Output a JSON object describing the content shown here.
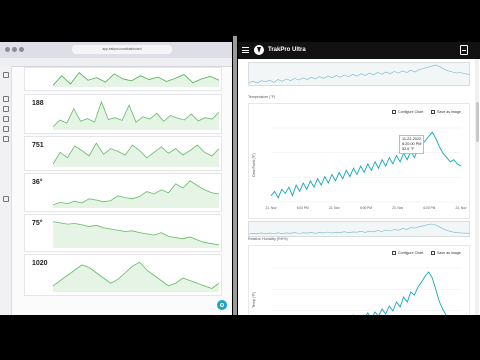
{
  "left_browser": {
    "url": "app.trakpro.com/dashboard",
    "panels": [
      {
        "value": "",
        "unit": "",
        "line_color": "#4caf50",
        "series": [
          40,
          55,
          42,
          60,
          48,
          52,
          45,
          58,
          50,
          47,
          55,
          49,
          53,
          46,
          51,
          57,
          44,
          50,
          54,
          48
        ]
      },
      {
        "value": "188",
        "unit": "",
        "line_color": "#66bb6a",
        "series": [
          30,
          45,
          38,
          70,
          42,
          48,
          40,
          85,
          46,
          50,
          44,
          78,
          40,
          52,
          47,
          60,
          42,
          55,
          49,
          45,
          58,
          43,
          50,
          47,
          62
        ]
      },
      {
        "value": "751",
        "unit": "",
        "line_color": "#66bb6a",
        "series": [
          35,
          48,
          42,
          55,
          50,
          44,
          58,
          46,
          52,
          49,
          45,
          56,
          50,
          42,
          48,
          54,
          47,
          52,
          45,
          50,
          56,
          48,
          44,
          52
        ]
      },
      {
        "value": "36",
        "unit": "°",
        "line_color": "#66bb6a",
        "series": [
          20,
          24,
          22,
          26,
          23,
          30,
          28,
          25,
          27,
          35,
          32,
          30,
          34,
          42,
          38,
          45,
          40,
          55,
          48,
          60,
          52,
          45,
          40,
          38
        ]
      },
      {
        "value": "75",
        "unit": "°",
        "line_color": "#66bb6a",
        "series": [
          60,
          58,
          56,
          57,
          55,
          52,
          54,
          50,
          48,
          46,
          44,
          45,
          42,
          40,
          38,
          42,
          36,
          34,
          32,
          35,
          30,
          26,
          24,
          22
        ]
      },
      {
        "value": "1020",
        "unit": "",
        "line_color": "#66bb6a",
        "series": [
          40,
          44,
          48,
          52,
          56,
          54,
          50,
          46,
          42,
          45,
          50,
          55,
          58,
          52,
          48,
          44,
          40,
          42,
          46,
          44,
          42,
          40,
          38,
          42
        ]
      }
    ]
  },
  "app": {
    "title": "TrakPro Ultra"
  },
  "right_charts": [
    {
      "section_label": "Temperature (°F)",
      "configure_label": "Configure Chart",
      "save_label": "Save as image",
      "ylabel": "Dew Point (°F)",
      "xticks": [
        "21. Nov",
        "6:00 PM",
        "22. Nov",
        "6:00 PM",
        "23. Nov",
        "6:00 PM",
        "24. Nov"
      ],
      "tooltip": [
        "11-22-2022",
        "6:20:00 PM",
        "52.6 °F"
      ],
      "line_color": "#19a3c3",
      "series": [
        38,
        42,
        36,
        44,
        40,
        46,
        38,
        48,
        42,
        50,
        44,
        52,
        46,
        54,
        48,
        56,
        50,
        58,
        52,
        60,
        54,
        62,
        56,
        64,
        58,
        66,
        60,
        68,
        62,
        70,
        64,
        72,
        66,
        74,
        68,
        76,
        70,
        78,
        72,
        80,
        74,
        82,
        86,
        90,
        94,
        98,
        92,
        84,
        78,
        74,
        70,
        72,
        68,
        66
      ]
    },
    {
      "section_label": "Relative Humidity (RH%)",
      "configure_label": "Configure Chart",
      "save_label": "Save as image",
      "ylabel": "Temp (°F)",
      "xticks": [
        "21. Nov",
        "6:00 PM",
        "22. Nov",
        "6:00 PM",
        "23. Nov",
        "6:00 PM",
        "24. Nov"
      ],
      "line_color": "#19a3c3",
      "series": [
        22,
        26,
        24,
        28,
        23,
        27,
        25,
        29,
        24,
        28,
        26,
        30,
        25,
        29,
        27,
        31,
        26,
        30,
        28,
        33,
        27,
        32,
        30,
        35,
        29,
        34,
        32,
        37,
        31,
        38,
        34,
        41,
        36,
        44,
        39,
        48,
        43,
        53,
        48,
        58,
        55,
        63,
        68,
        74,
        78,
        72,
        60,
        48,
        40,
        34,
        30,
        28,
        27,
        26
      ]
    }
  ]
}
